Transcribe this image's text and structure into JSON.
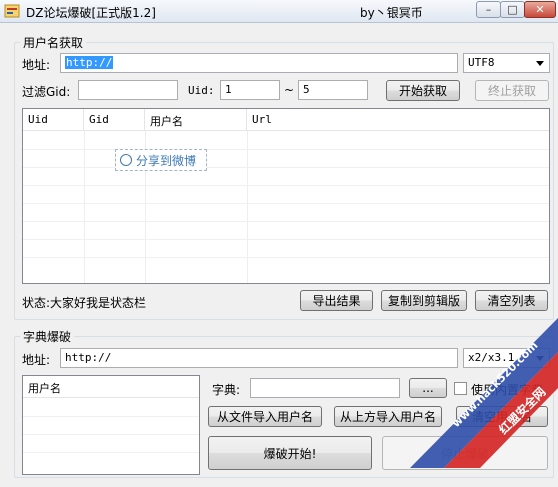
{
  "window": {
    "title": "DZ论坛爆破[正式版1.2]",
    "author": "by丶银冥币",
    "min_glyph": "–",
    "max_glyph": "□",
    "close_glyph": "✕"
  },
  "fetch_group": {
    "label": "用户名获取",
    "address_label": "地址:",
    "address_value": "http://",
    "encoding": "UTF8",
    "filter_label": "过滤Gid:",
    "filter_value": "",
    "uid_label": "Uid:",
    "uid_from": "1",
    "range_sep": "~",
    "uid_to": "5",
    "start_button": "开始获取",
    "stop_button": "终止获取",
    "columns": [
      "Uid",
      "Gid",
      "用户名",
      "Url"
    ],
    "share_popup": "分享到微博",
    "status_text": "状态:大家好我是状态栏",
    "export_button": "导出结果",
    "copy_button": "复制到剪辑版",
    "clear_button": "清空列表"
  },
  "dict_group": {
    "label": "字典爆破",
    "address_label": "地址:",
    "address_value": "http://",
    "version_select": "x2/x3.1",
    "user_list_header": "用户名",
    "dict_label": "字典:",
    "dict_value": "",
    "browse_button": "...",
    "builtin_checkbox_label": "使用内置字典",
    "import_file_button": "从文件导入用户名",
    "import_above_button": "从上方导入用户名",
    "clear_users_button": "清空用户名",
    "start_crack_button": "爆破开始!",
    "stop_crack_button": "停止爆破"
  },
  "watermark": {
    "line1": "www.hack520.com",
    "line2": "红盟安全网"
  },
  "colors": {
    "selection": "#3399ff",
    "watermark_red": "#d42626",
    "watermark_blue": "#2f4ea8",
    "link_blue": "#3c79b8"
  }
}
